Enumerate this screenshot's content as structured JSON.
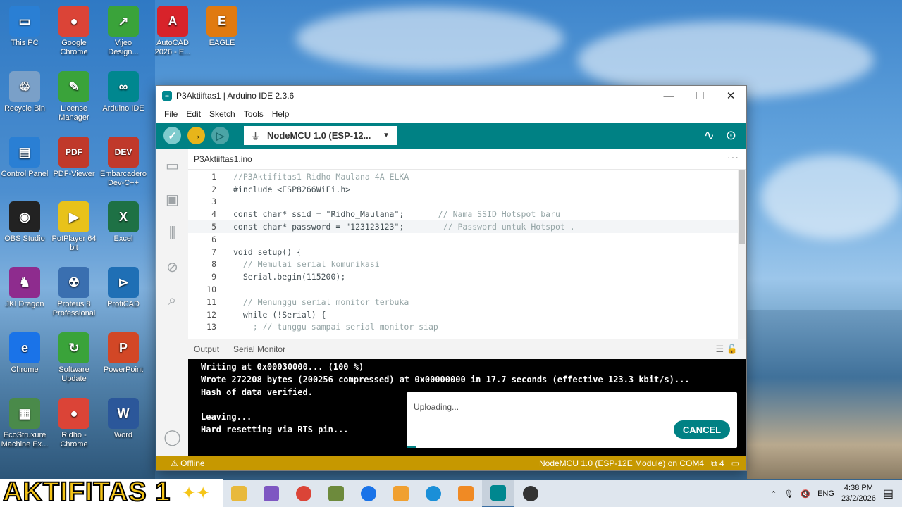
{
  "desktop": {
    "icons": [
      {
        "label": "This PC",
        "color": "#2a7fd4",
        "glyph": "▭"
      },
      {
        "label": "Google Chrome",
        "color": "#db4437",
        "glyph": "●"
      },
      {
        "label": "Vijeo Design...",
        "color": "#3aa33a",
        "glyph": "↗"
      },
      {
        "label": "AutoCAD 2026 - E...",
        "color": "#d8232a",
        "glyph": "A"
      },
      {
        "label": "EAGLE",
        "color": "#e07a10",
        "glyph": "E"
      },
      {
        "label": "Recycle Bin",
        "color": "#7aa0c8",
        "glyph": "♲"
      },
      {
        "label": "License Manager",
        "color": "#3aa33a",
        "glyph": "✎"
      },
      {
        "label": "Arduino IDE",
        "color": "#00878f",
        "glyph": "∞"
      },
      {
        "label": "Control Panel",
        "color": "#2a7fd4",
        "glyph": "▤"
      },
      {
        "label": "PDF-Viewer",
        "color": "#c0392b",
        "glyph": "PDF"
      },
      {
        "label": "Embarcadero Dev-C++",
        "color": "#c0392b",
        "glyph": "DEV"
      },
      {
        "label": "OBS Studio",
        "color": "#222222",
        "glyph": "◉"
      },
      {
        "label": "PotPlayer 64 bit",
        "color": "#e8c21a",
        "glyph": "▶"
      },
      {
        "label": "Excel",
        "color": "#1e7145",
        "glyph": "X"
      },
      {
        "label": "JKI Dragon",
        "color": "#8e2c8e",
        "glyph": "♞"
      },
      {
        "label": "Proteus 8 Professional",
        "color": "#3a6fb0",
        "glyph": "☢"
      },
      {
        "label": "ProfiCAD",
        "color": "#1f6fb5",
        "glyph": "⊳"
      },
      {
        "label": "Chrome",
        "color": "#1a73e8",
        "glyph": "e"
      },
      {
        "label": "Software Update",
        "color": "#3aa33a",
        "glyph": "↻"
      },
      {
        "label": "PowerPoint",
        "color": "#d24726",
        "glyph": "P"
      },
      {
        "label": "EcoStruxure Machine Ex...",
        "color": "#4a8a4a",
        "glyph": "▦"
      },
      {
        "label": "Ridho - Chrome",
        "color": "#db4437",
        "glyph": "●"
      },
      {
        "label": "Word",
        "color": "#2b579a",
        "glyph": "W"
      }
    ]
  },
  "window": {
    "title": "P3Aktiiftas1 | Arduino IDE 2.3.6",
    "controls": {
      "minimize": "—",
      "maximize": "☐",
      "close": "✕"
    },
    "menu": [
      "File",
      "Edit",
      "Sketch",
      "Tools",
      "Help"
    ],
    "toolbar": {
      "verify": "✓",
      "upload": "→",
      "debug": "▷",
      "board": "NodeMCU 1.0 (ESP-12...",
      "board_caret": "▼",
      "plotter": "∿",
      "monitor": "⊙"
    },
    "sidebar": [
      "▭",
      "▣",
      "⫼",
      "⊘",
      "⌕"
    ],
    "sidebar_profile": "◯",
    "tab": "P3Aktiiftas1.ino",
    "tab_more": "···",
    "code": [
      {
        "n": "1",
        "t": "//P3Aktifitas1 Ridho Maulana 4A ELKA",
        "comment": true
      },
      {
        "n": "2",
        "t": "#include <ESP8266WiFi.h>"
      },
      {
        "n": "3",
        "t": ""
      },
      {
        "n": "4",
        "t": "const char* ssid = \"Ridho_Maulana\";       // Nama SSID Hotspot baru"
      },
      {
        "n": "5",
        "t": "const char* password = \"123123123\";        // Password untuk Hotspot .",
        "active": true
      },
      {
        "n": "6",
        "t": ""
      },
      {
        "n": "7",
        "t": "void setup() {"
      },
      {
        "n": "8",
        "t": "  // Memulai serial komunikasi",
        "comment": true
      },
      {
        "n": "9",
        "t": "  Serial.begin(115200);"
      },
      {
        "n": "10",
        "t": ""
      },
      {
        "n": "11",
        "t": "  // Menunggu serial monitor terbuka",
        "comment": true
      },
      {
        "n": "12",
        "t": "  while (!Serial) {"
      },
      {
        "n": "13",
        "t": "    ; // tunggu sampai serial monitor siap",
        "comment": true
      }
    ],
    "output_tabs": {
      "output": "Output",
      "serial_monitor": "Serial Monitor",
      "icons": "☰ 🔓"
    },
    "console": [
      "Writing at 0x00030000... (100 %)",
      "Wrote 272208 bytes (200256 compressed) at 0x00000000 in 17.7 seconds (effective 123.3 kbit/s)...",
      "Hash of data verified.",
      "",
      "Leaving...",
      "Hard resetting via RTS pin..."
    ],
    "toast": {
      "message": "Uploading...",
      "cancel": "CANCEL",
      "progress": 0.03
    },
    "status": {
      "offline": "⚠ Offline",
      "board_port": "NodeMCU 1.0 (ESP-12E Module) on COM4",
      "notifications": "⧉ 4",
      "panel": "▭"
    }
  },
  "taskbar": {
    "banner": "AKTIFITAS 1",
    "banner_spark": "✦✦",
    "apps": [
      {
        "name": "file-explorer",
        "color": "#e8b93c"
      },
      {
        "name": "copilot",
        "color": "#7e57c2"
      },
      {
        "name": "chrome",
        "color": "#db4437"
      },
      {
        "name": "app-7",
        "color": "#6d8a3c"
      },
      {
        "name": "chrome-profile",
        "color": "#1a73e8"
      },
      {
        "name": "media-player",
        "color": "#f0a030"
      },
      {
        "name": "edge",
        "color": "#1a8fd8"
      },
      {
        "name": "sublime",
        "color": "#f08a24"
      },
      {
        "name": "arduino",
        "color": "#00878f",
        "active": true
      },
      {
        "name": "obs",
        "color": "#333333"
      }
    ],
    "tray": {
      "chevron": "⌃",
      "mic": "🎙",
      "volume": "🔇",
      "lang": "ENG",
      "time": "4:38 PM",
      "date": "23/2/2026",
      "notif": "▤"
    }
  }
}
